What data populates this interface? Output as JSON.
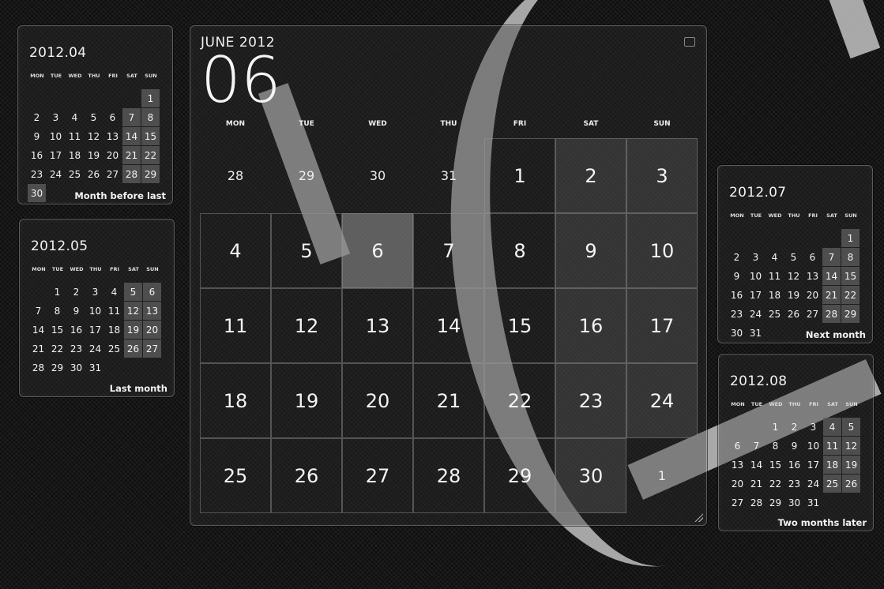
{
  "weekdays": [
    "MON",
    "TUE",
    "WED",
    "THU",
    "FRI",
    "SAT",
    "SUN"
  ],
  "main": {
    "month_label": "JUNE 2012",
    "day": "06",
    "today": 6,
    "weeks": [
      [
        {
          "d": "28",
          "ex": true
        },
        {
          "d": "29",
          "ex": true
        },
        {
          "d": "30",
          "ex": true
        },
        {
          "d": "31",
          "ex": true
        },
        {
          "d": "1"
        },
        {
          "d": "2"
        },
        {
          "d": "3"
        }
      ],
      [
        {
          "d": "4"
        },
        {
          "d": "5"
        },
        {
          "d": "6"
        },
        {
          "d": "7"
        },
        {
          "d": "8"
        },
        {
          "d": "9"
        },
        {
          "d": "10"
        }
      ],
      [
        {
          "d": "11"
        },
        {
          "d": "12"
        },
        {
          "d": "13"
        },
        {
          "d": "14"
        },
        {
          "d": "15"
        },
        {
          "d": "16"
        },
        {
          "d": "17"
        }
      ],
      [
        {
          "d": "18"
        },
        {
          "d": "19"
        },
        {
          "d": "20"
        },
        {
          "d": "21"
        },
        {
          "d": "22"
        },
        {
          "d": "23"
        },
        {
          "d": "24"
        }
      ],
      [
        {
          "d": "25"
        },
        {
          "d": "26"
        },
        {
          "d": "27"
        },
        {
          "d": "28"
        },
        {
          "d": "29"
        },
        {
          "d": "30"
        },
        {
          "d": "1",
          "ex": true
        }
      ]
    ]
  },
  "minis": [
    {
      "id": "apr",
      "title": "2012.04",
      "caption": "Month before last",
      "weeks": [
        [
          "",
          "",
          "",
          "",
          "",
          "",
          "1"
        ],
        [
          "2",
          "3",
          "4",
          "5",
          "6",
          "7",
          "8"
        ],
        [
          "9",
          "10",
          "11",
          "12",
          "13",
          "14",
          "15"
        ],
        [
          "16",
          "17",
          "18",
          "19",
          "20",
          "21",
          "22"
        ],
        [
          "23",
          "24",
          "25",
          "26",
          "27",
          "28",
          "29"
        ],
        [
          "30",
          "",
          "",
          "",
          "",
          "",
          ""
        ]
      ]
    },
    {
      "id": "may",
      "title": "2012.05",
      "caption": "Last month",
      "weeks": [
        [
          "",
          "1",
          "2",
          "3",
          "4",
          "5",
          "6"
        ],
        [
          "7",
          "8",
          "9",
          "10",
          "11",
          "12",
          "13"
        ],
        [
          "14",
          "15",
          "16",
          "17",
          "18",
          "19",
          "20"
        ],
        [
          "21",
          "22",
          "23",
          "24",
          "25",
          "26",
          "27"
        ],
        [
          "28",
          "29",
          "30",
          "31",
          "",
          "",
          ""
        ]
      ]
    },
    {
      "id": "jul",
      "title": "2012.07",
      "caption": "Next month",
      "weeks": [
        [
          "",
          "",
          "",
          "",
          "",
          "",
          "1"
        ],
        [
          "2",
          "3",
          "4",
          "5",
          "6",
          "7",
          "8"
        ],
        [
          "9",
          "10",
          "11",
          "12",
          "13",
          "14",
          "15"
        ],
        [
          "16",
          "17",
          "18",
          "19",
          "20",
          "21",
          "22"
        ],
        [
          "23",
          "24",
          "25",
          "26",
          "27",
          "28",
          "29"
        ],
        [
          "30",
          "31",
          "",
          "",
          "",
          "",
          ""
        ]
      ]
    },
    {
      "id": "aug",
      "title": "2012.08",
      "caption": "Two months later",
      "weeks": [
        [
          "",
          "",
          "1",
          "2",
          "3",
          "4",
          "5"
        ],
        [
          "6",
          "7",
          "8",
          "9",
          "10",
          "11",
          "12"
        ],
        [
          "13",
          "14",
          "15",
          "16",
          "17",
          "18",
          "19"
        ],
        [
          "20",
          "21",
          "22",
          "23",
          "24",
          "25",
          "26"
        ],
        [
          "27",
          "28",
          "29",
          "30",
          "31",
          "",
          ""
        ]
      ]
    }
  ]
}
